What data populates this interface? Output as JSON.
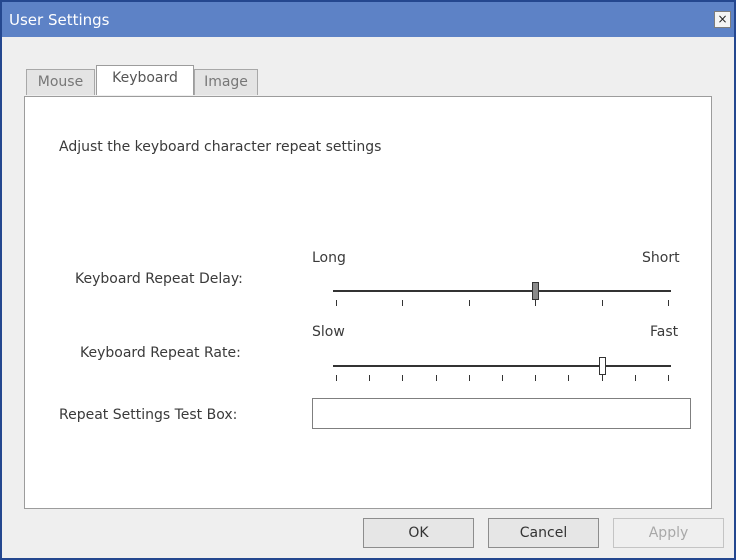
{
  "window": {
    "title": "User Settings",
    "close_symbol": "×"
  },
  "tabs": [
    {
      "label": "Mouse",
      "active": false
    },
    {
      "label": "Keyboard",
      "active": true
    },
    {
      "label": "Image",
      "active": false
    }
  ],
  "keyboard": {
    "description": "Adjust the keyboard character repeat settings",
    "repeat_delay": {
      "label": "Keyboard Repeat Delay:",
      "min_label": "Long",
      "max_label": "Short",
      "steps": 5,
      "value": 3
    },
    "repeat_rate": {
      "label": "Keyboard Repeat Rate:",
      "min_label": "Slow",
      "max_label": "Fast",
      "steps": 10,
      "value": 8
    },
    "test_box": {
      "label": "Repeat Settings Test Box:",
      "value": ""
    }
  },
  "buttons": {
    "ok": "OK",
    "cancel": "Cancel",
    "apply": "Apply"
  },
  "colors": {
    "titlebar": "#5d82c6",
    "border": "#24478f",
    "background": "#efefef"
  }
}
